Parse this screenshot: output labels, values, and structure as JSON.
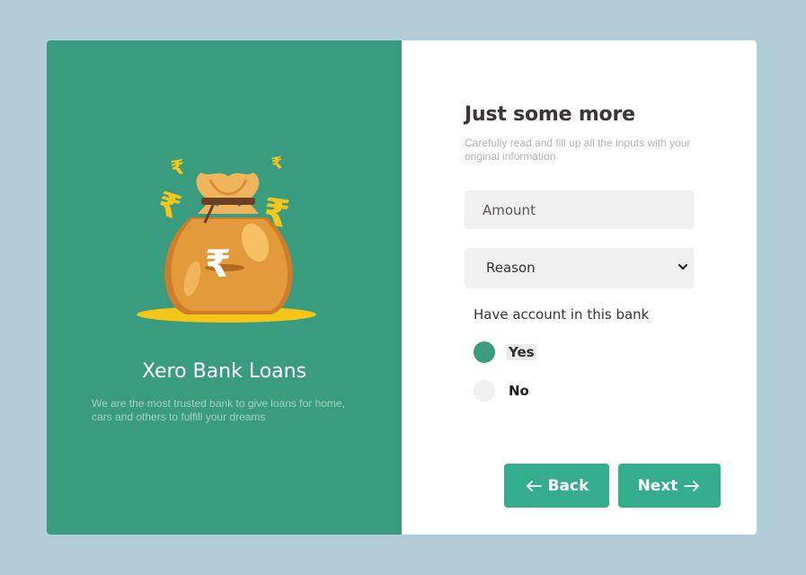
{
  "brand": {
    "title": "Xero Bank Loans",
    "description": "We are the most trusted bank to give loans for home, cars and others to fulfill your dreams"
  },
  "form": {
    "title": "Just some more",
    "subtitle": "Carefully read and fill up all the inputs with your original information",
    "amount": {
      "placeholder": "Amount",
      "value": ""
    },
    "reason": {
      "selected": "Reason"
    },
    "account_question": "Have account in this bank",
    "options": [
      {
        "label": "Yes",
        "checked": true
      },
      {
        "label": "No",
        "checked": false
      }
    ],
    "back_label": "Back",
    "next_label": "Next"
  },
  "colors": {
    "page_background": "#b2cdd8",
    "panel_green": "#3a9c7e",
    "button_green": "#33ad8b",
    "input_gray": "#f0f0f0",
    "bag_orange": "#e39a3b",
    "coin_yellow": "#f5c518"
  },
  "icons": {
    "illustration": "money-bag-rupee-icon",
    "back": "arrow-left-icon",
    "next": "arrow-right-icon",
    "select": "chevron-down-icon"
  }
}
